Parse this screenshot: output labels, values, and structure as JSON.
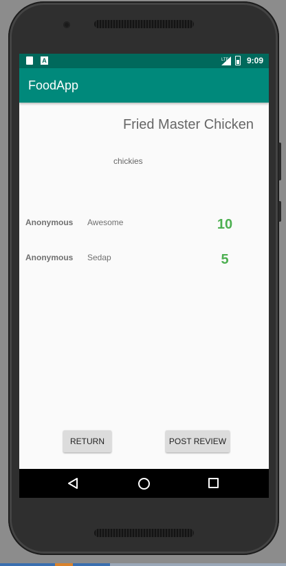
{
  "status_bar": {
    "time": "9:09",
    "sd_icon": "sd-card-icon",
    "a_icon_label": "A",
    "signal_label": "LTE"
  },
  "app_bar": {
    "title": "FoodApp",
    "color": "#00897b"
  },
  "food": {
    "name": "Fried Master Chicken",
    "description": "chickies"
  },
  "reviews": [
    {
      "author": "Anonymous",
      "comment": "Awesome",
      "rating": "10"
    },
    {
      "author": "Anonymous",
      "comment": "Sedap",
      "rating": "5"
    }
  ],
  "buttons": {
    "return_label": "RETURN",
    "post_review_label": "POST REVIEW"
  },
  "nav_bar": {
    "back_icon": "back-triangle-icon",
    "home_icon": "home-circle-icon",
    "recents_icon": "recents-square-icon"
  },
  "colors": {
    "status_bar": "#00695c",
    "rating": "#4caf50"
  }
}
